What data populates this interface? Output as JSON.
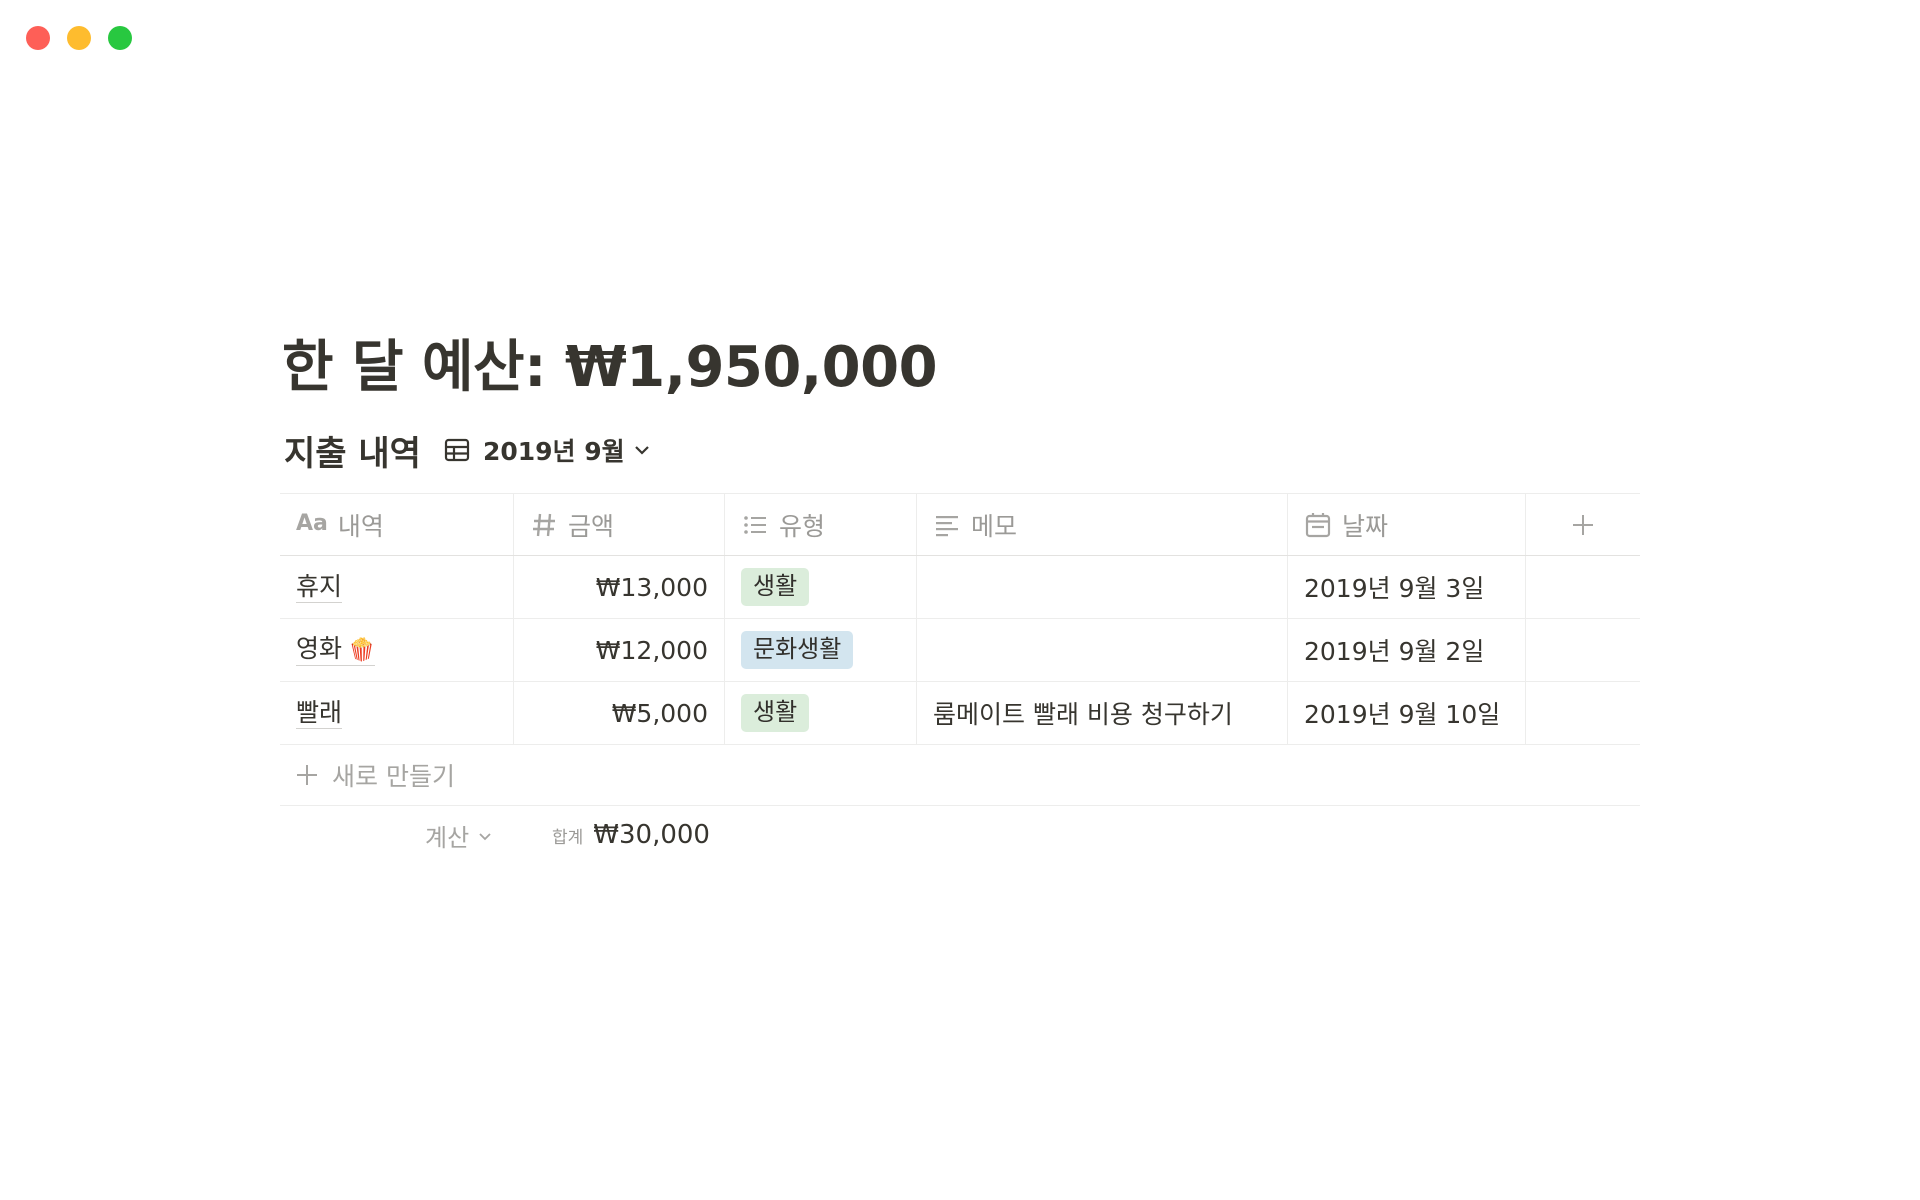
{
  "page": {
    "title": "한 달 예산: ₩1,950,000"
  },
  "database": {
    "title": "지출 내역",
    "view_name": "2019년 9월"
  },
  "columns": [
    {
      "label": "내역",
      "icon": "Aa",
      "icon_name": "title-icon"
    },
    {
      "label": "금액",
      "icon_name": "number-icon"
    },
    {
      "label": "유형",
      "icon_name": "list-icon"
    },
    {
      "label": "메모",
      "icon_name": "text-icon"
    },
    {
      "label": "날짜",
      "icon_name": "calendar-icon"
    }
  ],
  "rows": [
    {
      "name": "휴지",
      "emoji": "",
      "amount": "₩13,000",
      "type": "생활",
      "type_color": "#dbeddb",
      "memo": "",
      "date": "2019년 9월 3일"
    },
    {
      "name": "영화",
      "emoji": "🍿",
      "amount": "₩12,000",
      "type": "문화생활",
      "type_color": "#d3e5ef",
      "memo": "",
      "date": "2019년 9월 2일"
    },
    {
      "name": "빨래",
      "emoji": "",
      "amount": "₩5,000",
      "type": "생활",
      "type_color": "#dbeddb",
      "memo": "룸메이트 빨래 비용 청구하기",
      "date": "2019년 9월 10일"
    }
  ],
  "new_row_label": "새로 만들기",
  "footer": {
    "calc_label": "계산",
    "sum_label": "합계",
    "sum_value": "₩30,000"
  },
  "colors": {
    "text": "#37352f",
    "muted": "#9b9a97",
    "tag_green": "#dbeddb",
    "tag_blue": "#d3e5ef"
  }
}
